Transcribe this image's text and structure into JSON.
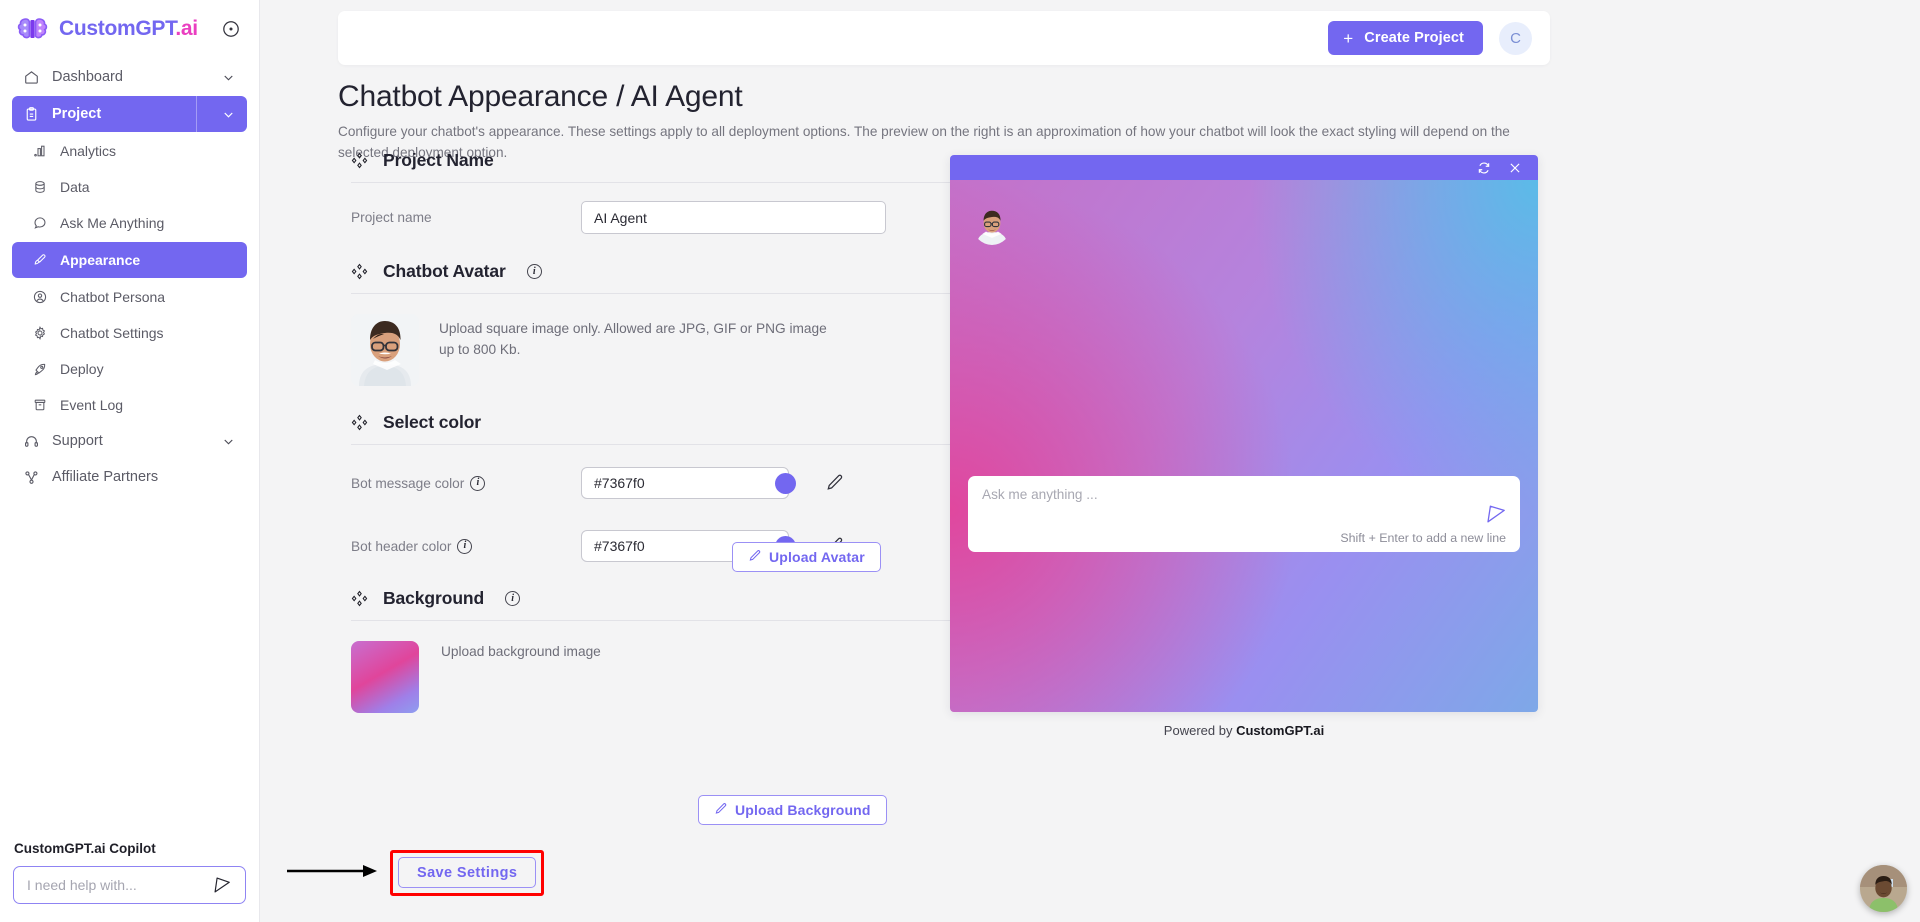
{
  "brand": {
    "name_part1": "CustomGPT",
    "name_part2": ".ai",
    "collapse_icon": "circle-dot-icon"
  },
  "sidebar": {
    "items": [
      {
        "label": "Dashboard",
        "icon": "home-icon",
        "chevron": true,
        "level": "top",
        "state": "normal"
      },
      {
        "label": "Project",
        "icon": "clipboard-icon",
        "chevron": true,
        "level": "top",
        "state": "active-split"
      },
      {
        "label": "Analytics",
        "icon": "bar-chart-icon",
        "level": "sub",
        "state": "normal"
      },
      {
        "label": "Data",
        "icon": "database-icon",
        "level": "sub",
        "state": "normal"
      },
      {
        "label": "Ask Me Anything",
        "icon": "chat-bubble-icon",
        "level": "sub",
        "state": "normal"
      },
      {
        "label": "Appearance",
        "icon": "paint-brush-icon",
        "level": "sub",
        "state": "active"
      },
      {
        "label": "Chatbot Persona",
        "icon": "user-circle-icon",
        "level": "sub",
        "state": "normal"
      },
      {
        "label": "Chatbot Settings",
        "icon": "gear-icon",
        "level": "sub",
        "state": "normal"
      },
      {
        "label": "Deploy",
        "icon": "rocket-icon",
        "level": "sub",
        "state": "normal"
      },
      {
        "label": "Event Log",
        "icon": "archive-icon",
        "level": "sub",
        "state": "normal"
      },
      {
        "label": "Support",
        "icon": "headset-icon",
        "chevron": true,
        "level": "top",
        "state": "normal"
      },
      {
        "label": "Affiliate Partners",
        "icon": "share-nodes-icon",
        "level": "top",
        "state": "normal"
      }
    ],
    "copilot": {
      "title": "CustomGPT.ai Copilot",
      "input_placeholder": "I need help with...",
      "input_value": "",
      "send_icon": "paper-plane-icon"
    }
  },
  "topbar": {
    "create_project_label": "Create Project",
    "create_project_plus": "+",
    "user_avatar_initial": "C"
  },
  "page": {
    "title": "Chatbot Appearance / AI Agent",
    "subtitle": "Configure your chatbot's appearance. These settings apply to all deployment options. The preview on the right is an approximation of how your chatbot will look the exact styling will depend on the selected deployment option."
  },
  "sections": {
    "project_name": {
      "heading": "Project Name",
      "field_label": "Project name",
      "field_value": "AI Agent",
      "field_placeholder": "Project name"
    },
    "chatbot_avatar": {
      "heading": "Chatbot Avatar",
      "has_info": true,
      "description": "Upload square image only. Allowed are JPG, GIF or PNG image up to 800 Kb.",
      "upload_label": "Upload Avatar",
      "upload_icon": "pencil-icon"
    },
    "select_color": {
      "heading": "Select color",
      "rows": [
        {
          "label": "Bot message color",
          "value": "#7367f0",
          "swatch": "#7367f0",
          "has_info": true,
          "edit_icon": "pencil-icon"
        },
        {
          "label": "Bot header color",
          "value": "#7367f0",
          "swatch": "#7367f0",
          "has_info": true,
          "edit_icon": "pencil-icon"
        }
      ]
    },
    "background": {
      "heading": "Background",
      "has_info": true,
      "description": "Upload background image",
      "upload_label": "Upload Background",
      "upload_icon": "pencil-icon"
    },
    "save": {
      "label": "Save Settings",
      "highlight_color": "#ff0000",
      "annotation_icon": "arrow-right-icon"
    }
  },
  "preview": {
    "header_color": "#7367f0",
    "refresh_icon": "refresh-icon",
    "close_icon": "close-icon",
    "bot_avatar": "bot-avatar-image",
    "input_placeholder": "Ask me anything ...",
    "hint": "Shift + Enter to add a new line",
    "send_icon": "paper-plane-icon",
    "powered_prefix": "Powered by ",
    "powered_brand": "CustomGPT.ai"
  },
  "fab": {
    "icon": "support-agent-avatar"
  }
}
